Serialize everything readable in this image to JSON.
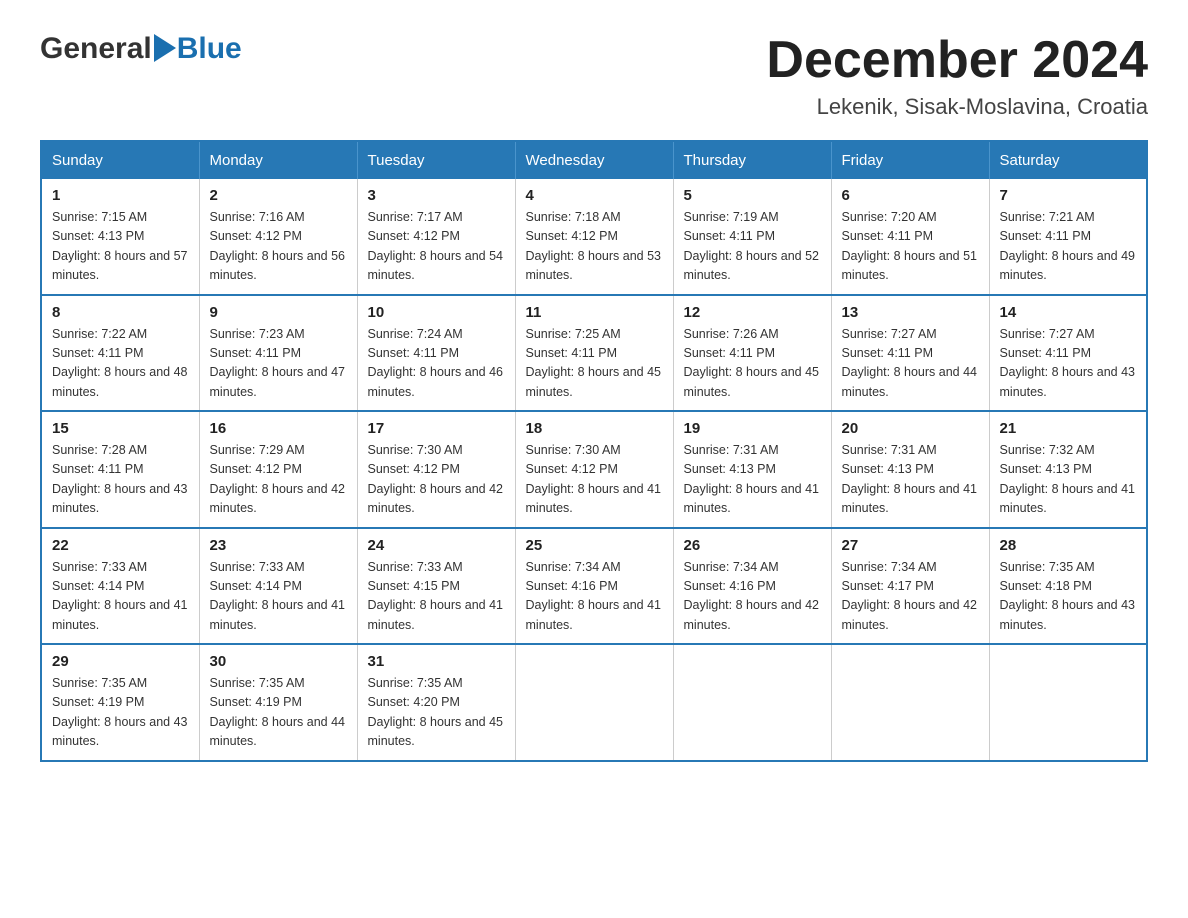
{
  "header": {
    "logo_general": "General",
    "logo_blue": "Blue",
    "title": "December 2024",
    "subtitle": "Lekenik, Sisak-Moslavina, Croatia"
  },
  "calendar": {
    "days_of_week": [
      "Sunday",
      "Monday",
      "Tuesday",
      "Wednesday",
      "Thursday",
      "Friday",
      "Saturday"
    ],
    "weeks": [
      [
        {
          "day": "1",
          "sunrise": "7:15 AM",
          "sunset": "4:13 PM",
          "daylight": "8 hours and 57 minutes."
        },
        {
          "day": "2",
          "sunrise": "7:16 AM",
          "sunset": "4:12 PM",
          "daylight": "8 hours and 56 minutes."
        },
        {
          "day": "3",
          "sunrise": "7:17 AM",
          "sunset": "4:12 PM",
          "daylight": "8 hours and 54 minutes."
        },
        {
          "day": "4",
          "sunrise": "7:18 AM",
          "sunset": "4:12 PM",
          "daylight": "8 hours and 53 minutes."
        },
        {
          "day": "5",
          "sunrise": "7:19 AM",
          "sunset": "4:11 PM",
          "daylight": "8 hours and 52 minutes."
        },
        {
          "day": "6",
          "sunrise": "7:20 AM",
          "sunset": "4:11 PM",
          "daylight": "8 hours and 51 minutes."
        },
        {
          "day": "7",
          "sunrise": "7:21 AM",
          "sunset": "4:11 PM",
          "daylight": "8 hours and 49 minutes."
        }
      ],
      [
        {
          "day": "8",
          "sunrise": "7:22 AM",
          "sunset": "4:11 PM",
          "daylight": "8 hours and 48 minutes."
        },
        {
          "day": "9",
          "sunrise": "7:23 AM",
          "sunset": "4:11 PM",
          "daylight": "8 hours and 47 minutes."
        },
        {
          "day": "10",
          "sunrise": "7:24 AM",
          "sunset": "4:11 PM",
          "daylight": "8 hours and 46 minutes."
        },
        {
          "day": "11",
          "sunrise": "7:25 AM",
          "sunset": "4:11 PM",
          "daylight": "8 hours and 45 minutes."
        },
        {
          "day": "12",
          "sunrise": "7:26 AM",
          "sunset": "4:11 PM",
          "daylight": "8 hours and 45 minutes."
        },
        {
          "day": "13",
          "sunrise": "7:27 AM",
          "sunset": "4:11 PM",
          "daylight": "8 hours and 44 minutes."
        },
        {
          "day": "14",
          "sunrise": "7:27 AM",
          "sunset": "4:11 PM",
          "daylight": "8 hours and 43 minutes."
        }
      ],
      [
        {
          "day": "15",
          "sunrise": "7:28 AM",
          "sunset": "4:11 PM",
          "daylight": "8 hours and 43 minutes."
        },
        {
          "day": "16",
          "sunrise": "7:29 AM",
          "sunset": "4:12 PM",
          "daylight": "8 hours and 42 minutes."
        },
        {
          "day": "17",
          "sunrise": "7:30 AM",
          "sunset": "4:12 PM",
          "daylight": "8 hours and 42 minutes."
        },
        {
          "day": "18",
          "sunrise": "7:30 AM",
          "sunset": "4:12 PM",
          "daylight": "8 hours and 41 minutes."
        },
        {
          "day": "19",
          "sunrise": "7:31 AM",
          "sunset": "4:13 PM",
          "daylight": "8 hours and 41 minutes."
        },
        {
          "day": "20",
          "sunrise": "7:31 AM",
          "sunset": "4:13 PM",
          "daylight": "8 hours and 41 minutes."
        },
        {
          "day": "21",
          "sunrise": "7:32 AM",
          "sunset": "4:13 PM",
          "daylight": "8 hours and 41 minutes."
        }
      ],
      [
        {
          "day": "22",
          "sunrise": "7:33 AM",
          "sunset": "4:14 PM",
          "daylight": "8 hours and 41 minutes."
        },
        {
          "day": "23",
          "sunrise": "7:33 AM",
          "sunset": "4:14 PM",
          "daylight": "8 hours and 41 minutes."
        },
        {
          "day": "24",
          "sunrise": "7:33 AM",
          "sunset": "4:15 PM",
          "daylight": "8 hours and 41 minutes."
        },
        {
          "day": "25",
          "sunrise": "7:34 AM",
          "sunset": "4:16 PM",
          "daylight": "8 hours and 41 minutes."
        },
        {
          "day": "26",
          "sunrise": "7:34 AM",
          "sunset": "4:16 PM",
          "daylight": "8 hours and 42 minutes."
        },
        {
          "day": "27",
          "sunrise": "7:34 AM",
          "sunset": "4:17 PM",
          "daylight": "8 hours and 42 minutes."
        },
        {
          "day": "28",
          "sunrise": "7:35 AM",
          "sunset": "4:18 PM",
          "daylight": "8 hours and 43 minutes."
        }
      ],
      [
        {
          "day": "29",
          "sunrise": "7:35 AM",
          "sunset": "4:19 PM",
          "daylight": "8 hours and 43 minutes."
        },
        {
          "day": "30",
          "sunrise": "7:35 AM",
          "sunset": "4:19 PM",
          "daylight": "8 hours and 44 minutes."
        },
        {
          "day": "31",
          "sunrise": "7:35 AM",
          "sunset": "4:20 PM",
          "daylight": "8 hours and 45 minutes."
        },
        null,
        null,
        null,
        null
      ]
    ]
  }
}
